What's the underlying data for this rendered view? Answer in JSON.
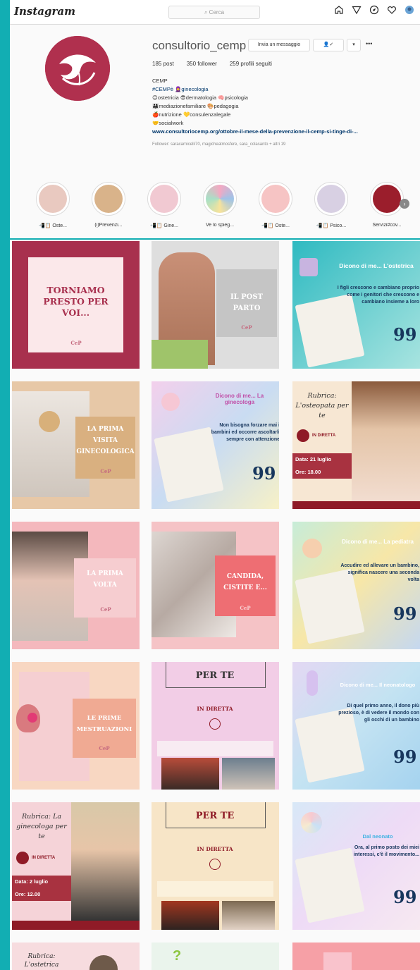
{
  "app": {
    "title": "Instagram",
    "search_placeholder": "Cerca"
  },
  "profile": {
    "username": "consultorio_cemp",
    "message_button": "Invia un messaggio",
    "follow_button": "✓",
    "more_button": "•••",
    "stats": {
      "posts": "185 post",
      "followers": "350 follower",
      "following": "259 profili seguiti"
    },
    "bio": {
      "name": "CEMP",
      "line1": "#CEMPè 🧕ginecologia",
      "line2": "😊ostetricia 😎dermatologia 🧠psicologia",
      "line3": "👨‍👩‍👧mediazionefamiliare 🎨pedagogia",
      "line4": "🍎nutrizione 💛consulenzalegale",
      "line5": "🤝socialwork",
      "link": "www.consultoriocemp.org/ottobre-il-mese-della-prevenzione-il-cemp-si-tinge-di-...",
      "followed_by": "Follower: saracarnicelli70, magicheatmosfere, sara_colasanto + altri 19"
    }
  },
  "highlights": [
    {
      "label": "📲📋 Oste...",
      "color": "#e9c9c0"
    },
    {
      "label": "(i)Prevenzi...",
      "color": "#d9b38a"
    },
    {
      "label": "📲📋 Gine...",
      "color": "#f1c9d2"
    },
    {
      "label": "Ve lo spieg...",
      "color": "#9fc3e8"
    },
    {
      "label": "📲📋 Oste...",
      "color": "#f6c4c4"
    },
    {
      "label": "📲📋 Psico...",
      "color": "#d8d0e3"
    },
    {
      "label": "Servizi#cov...",
      "color": "#9b1e2c"
    }
  ],
  "posts": {
    "p1": "TORNIAMO PRESTO PER VOI...",
    "p2": "IL POST PARTO",
    "p3_title": "Dicono di me... L'ostetrica",
    "p3_text": "I figli crescono e cambiano proprio come i genitori che crescono e cambiano insieme a loro",
    "p4": "LA PRIMA VISITA GINECOLOGICA",
    "p5_title": "Dicono di me... La ginecologa",
    "p5_text": "Non bisogna forzare mai i bambini ed occorre ascoltarli sempre con attenzione",
    "p6_title": "Rubrica: L'osteopata per te",
    "p6_live": "IN DIRETTA",
    "p6_date": "Data: 21 luglio",
    "p6_time": "Ore: 18.00",
    "p7": "LA PRIMA VOLTA",
    "p8": "CANDIDA, CISTITE E...",
    "p9_title": "Dicono di me... La pediatra",
    "p9_text": "Accudire ed allevare un bambino, significa nascere una seconda volta",
    "p10": "LE PRIME MESTRUAZIONI",
    "p11_title": "PER TE",
    "p11_live": "IN DIRETTA",
    "p12_title": "Dicono di me... Il neonatologo",
    "p12_text": "Di quel primo anno, il dono più prezioso, è di vedere il mondo con gli occhi di un bambino",
    "p13_title": "Rubrica: La ginecologa per te",
    "p13_live": "IN DIRETTA",
    "p13_date": "Data: 2 luglio",
    "p13_time": "Ore: 12.00",
    "p14_title": "PER TE",
    "p14_live": "IN DIRETTA",
    "p15_title": "Dal neonato",
    "p15_text": "Ora, al primo posto dei miei interessi, c'è il movimento...",
    "p16_title": "Rubrica: L'ostetrica"
  },
  "quote_mark": "99",
  "logo_mark": "CeP",
  "colors": {
    "accent": "#12aeb3",
    "brand": "#b0304e",
    "link": "#00376b"
  }
}
